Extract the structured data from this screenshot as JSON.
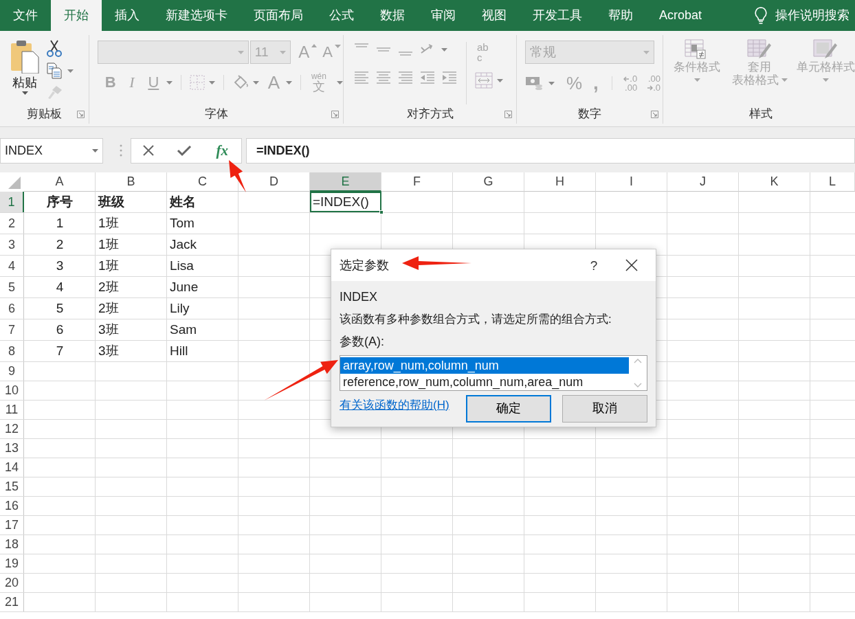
{
  "menu_tabs": [
    {
      "label": "文件",
      "selected": false
    },
    {
      "label": "开始",
      "selected": true
    },
    {
      "label": "插入",
      "selected": false
    },
    {
      "label": "新建选项卡",
      "selected": false
    },
    {
      "label": "页面布局",
      "selected": false
    },
    {
      "label": "公式",
      "selected": false
    },
    {
      "label": "数据",
      "selected": false
    },
    {
      "label": "审阅",
      "selected": false
    },
    {
      "label": "视图",
      "selected": false
    },
    {
      "label": "开发工具",
      "selected": false
    },
    {
      "label": "帮助",
      "selected": false
    },
    {
      "label": "Acrobat",
      "selected": false
    }
  ],
  "tell_me": {
    "label": "操作说明搜索"
  },
  "ribbon": {
    "clipboard": {
      "label": "剪贴板",
      "launcher": true,
      "paste": "粘贴"
    },
    "font": {
      "label": "字体",
      "launcher": true,
      "font_size": "11",
      "grow": "A",
      "shrink": "A",
      "styles": [
        "B",
        "I",
        "U"
      ],
      "font_color": "A",
      "phonetic": [
        "wén",
        "文"
      ]
    },
    "alignment": {
      "label": "对齐方式",
      "launcher": true,
      "wrap_text": [
        "ab",
        "c"
      ]
    },
    "number": {
      "label": "数字",
      "launcher": true,
      "format": "常规",
      "percent": "%",
      "comma": ",",
      "increase_decimal": [
        ".0",
        ".00"
      ],
      "decrease_decimal": [
        ".00",
        ".0"
      ]
    },
    "styles": {
      "label": "样式",
      "launcher": false,
      "buttons": [
        {
          "lines": [
            "条件格式"
          ],
          "disabled": true
        },
        {
          "lines": [
            "套用",
            "表格格式"
          ],
          "disabled": true
        },
        {
          "lines": [
            "单元格样式"
          ],
          "disabled": true
        }
      ]
    }
  },
  "formula_bar": {
    "name_box": "INDEX",
    "fx": "fx",
    "formula": "=INDEX()"
  },
  "sheet": {
    "columns": [
      {
        "label": "A",
        "selected": false
      },
      {
        "label": "B",
        "selected": false
      },
      {
        "label": "C",
        "selected": false
      },
      {
        "label": "D",
        "selected": false
      },
      {
        "label": "E",
        "selected": true
      },
      {
        "label": "F",
        "selected": false
      },
      {
        "label": "G",
        "selected": false
      },
      {
        "label": "H",
        "selected": false
      },
      {
        "label": "I",
        "selected": false
      },
      {
        "label": "J",
        "selected": false
      },
      {
        "label": "K",
        "selected": false
      },
      {
        "label": "L",
        "selected": false
      }
    ],
    "rows": [
      {
        "label": "1",
        "selected": true,
        "kind": "header",
        "cells": [
          "序号",
          "班级",
          "姓名"
        ]
      },
      {
        "label": "2",
        "selected": false,
        "kind": "data",
        "cells": [
          "1",
          "1班",
          "Tom"
        ]
      },
      {
        "label": "3",
        "selected": false,
        "kind": "data",
        "cells": [
          "2",
          "1班",
          "Jack"
        ]
      },
      {
        "label": "4",
        "selected": false,
        "kind": "data",
        "cells": [
          "3",
          "1班",
          "Lisa"
        ]
      },
      {
        "label": "5",
        "selected": false,
        "kind": "data",
        "cells": [
          "4",
          "2班",
          "June"
        ]
      },
      {
        "label": "6",
        "selected": false,
        "kind": "data",
        "cells": [
          "5",
          "2班",
          "Lily"
        ]
      },
      {
        "label": "7",
        "selected": false,
        "kind": "data",
        "cells": [
          "6",
          "3班",
          "Sam"
        ]
      },
      {
        "label": "8",
        "selected": false,
        "kind": "data",
        "cells": [
          "7",
          "3班",
          "Hill"
        ]
      },
      {
        "label": "9",
        "selected": false,
        "kind": "blank"
      },
      {
        "label": "10",
        "selected": false,
        "kind": "blank"
      },
      {
        "label": "11",
        "selected": false,
        "kind": "blank"
      },
      {
        "label": "12",
        "selected": false,
        "kind": "blank"
      },
      {
        "label": "13",
        "selected": false,
        "kind": "blank"
      },
      {
        "label": "14",
        "selected": false,
        "kind": "blank"
      },
      {
        "label": "15",
        "selected": false,
        "kind": "blank"
      },
      {
        "label": "16",
        "selected": false,
        "kind": "blank"
      },
      {
        "label": "17",
        "selected": false,
        "kind": "blank"
      },
      {
        "label": "18",
        "selected": false,
        "kind": "blank"
      },
      {
        "label": "19",
        "selected": false,
        "kind": "blank"
      },
      {
        "label": "20",
        "selected": false,
        "kind": "blank"
      },
      {
        "label": "21",
        "selected": false,
        "kind": "blank"
      }
    ],
    "active_cell": {
      "value": "=INDEX()"
    }
  },
  "dialog": {
    "title": "选定参数",
    "help": "?",
    "function_name": "INDEX",
    "description": "该函数有多种参数组合方式，请选定所需的组合方式:",
    "list_label": "参数(A):",
    "options": [
      {
        "label": "array,row_num,column_num",
        "selected": true
      },
      {
        "label": "reference,row_num,column_num,area_num",
        "selected": false
      }
    ],
    "help_link": "有关该函数的帮助(H)",
    "buttons": [
      {
        "label": "确定",
        "kind": "default"
      },
      {
        "label": "取消",
        "kind": "normal"
      }
    ]
  }
}
